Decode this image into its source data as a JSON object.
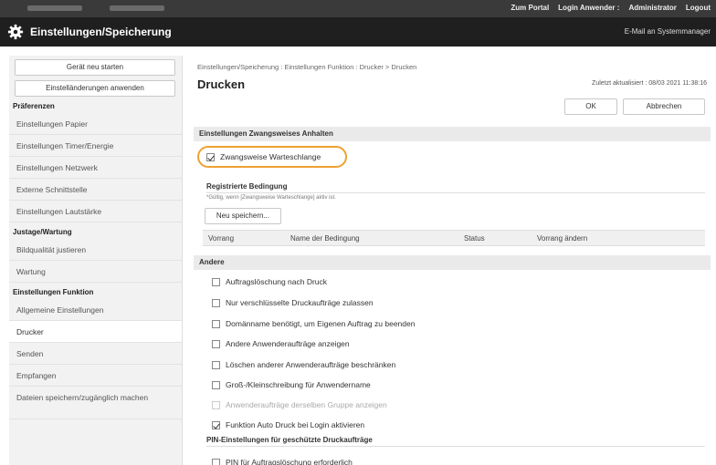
{
  "topbar": {
    "links": [
      "Zum Portal",
      "Login Anwender :",
      "Administrator",
      "Logout"
    ]
  },
  "header": {
    "title": "Einstellungen/Speicherung",
    "mail_link": "E-Mail an Systemmanager"
  },
  "sidebar": {
    "restart_button": "Gerät neu starten",
    "apply_button": "Einstelländerungen anwenden",
    "groups": [
      {
        "label": "Präferenzen",
        "items": [
          "Einstellungen Papier",
          "Einstellungen Timer/Energie",
          "Einstellungen Netzwerk",
          "Externe Schnittstelle",
          "Einstellungen Lautstärke"
        ]
      },
      {
        "label": "Justage/Wartung",
        "items": [
          "Bildqualität justieren",
          "Wartung"
        ]
      },
      {
        "label": "Einstellungen Funktion",
        "items": [
          "Allgemeine Einstellungen",
          "Drucker",
          "Senden",
          "Empfangen",
          "Dateien speichern/zugänglich machen"
        ]
      }
    ],
    "active_item": "Drucker"
  },
  "main": {
    "breadcrumb": "Einstellungen/Speicherung : Einstellungen Funktion : Drucker > Drucken",
    "title": "Drucken",
    "last_updated": "Zuletzt aktualisiert : 08/03 2021 11:38:16",
    "ok_label": "OK",
    "cancel_label": "Abbrechen",
    "forced_section": {
      "title": "Einstellungen Zwangsweises Anhalten",
      "checkbox_label": "Zwangsweise Warteschlange",
      "checked": true
    },
    "registered": {
      "title": "Registrierte Bedingung",
      "note": "*Gültig, wenn [Zwangsweise Warteschlange] aktiv ist.",
      "save_new": "Neu speichern...",
      "columns": [
        "Vorrang",
        "Name der Bedingung",
        "Status",
        "Vorrang ändern"
      ]
    },
    "other": {
      "title": "Andere",
      "options": [
        {
          "label": "Auftragslöschung nach Druck",
          "checked": false,
          "disabled": false
        },
        {
          "label": "Nur verschlüsselte Druckaufträge zulassen",
          "checked": false,
          "disabled": false
        },
        {
          "label": "Domänname benötigt, um Eigenen Auftrag zu beenden",
          "checked": false,
          "disabled": false
        },
        {
          "label": "Andere Anwenderaufträge anzeigen",
          "checked": false,
          "disabled": false
        },
        {
          "label": "Löschen anderer Anwenderaufträge beschränken",
          "checked": false,
          "disabled": false
        },
        {
          "label": "Groß-/Kleinschreibung für Anwendername",
          "checked": false,
          "disabled": false
        },
        {
          "label": "Anwenderaufträge derselben Gruppe anzeigen",
          "checked": false,
          "disabled": true
        },
        {
          "label": "Funktion Auto Druck bei Login aktivieren",
          "checked": true,
          "disabled": false
        }
      ]
    },
    "pin": {
      "title": "PIN-Einstellungen für geschützte Druckaufträge",
      "options": [
        {
          "label": "PIN für Auftragslöschung erforderlich",
          "checked": false
        }
      ]
    }
  }
}
